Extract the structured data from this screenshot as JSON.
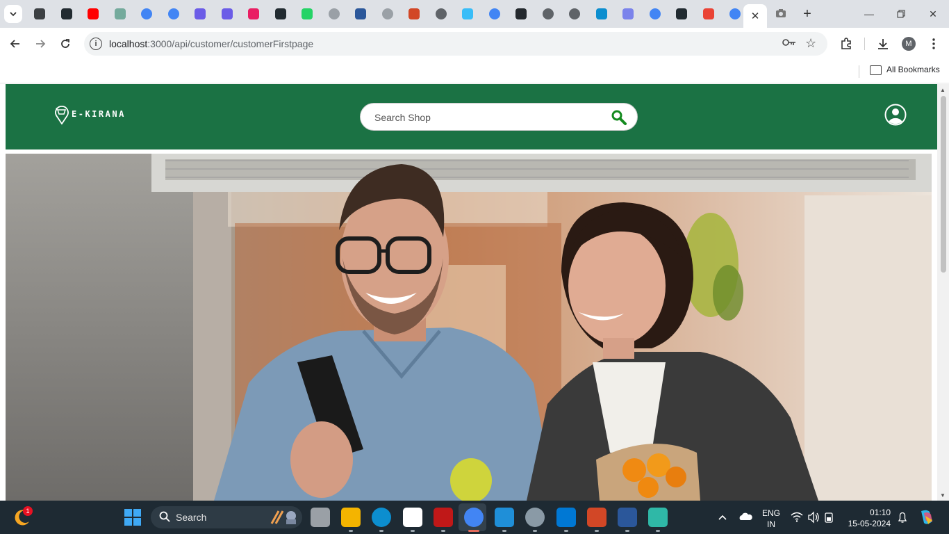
{
  "browser": {
    "address_bar": {
      "host": "localhost",
      "path": ":3000/api/customer/customerFirstpage"
    },
    "bookmarks_bar": {
      "all_bookmarks_label": "All Bookmarks"
    },
    "profile_initial": "M",
    "tabs": [
      {
        "icon": "maps-stack-icon",
        "color": "#3c4043"
      },
      {
        "icon": "react-app-icon",
        "color": "#222b31"
      },
      {
        "icon": "youtube-icon",
        "color": "#ff0000"
      },
      {
        "icon": "chatgpt-icon",
        "color": "#74aa9c"
      },
      {
        "icon": "google-icon",
        "color": "#4285f4"
      },
      {
        "icon": "google-icon",
        "color": "#4285f4"
      },
      {
        "icon": "copilot-icon",
        "color": "#6b5ce7"
      },
      {
        "icon": "copilot-icon",
        "color": "#6b5ce7"
      },
      {
        "icon": "react-icon",
        "color": "#e91e63"
      },
      {
        "icon": "react-app-icon",
        "color": "#222b31"
      },
      {
        "icon": "whatsapp-icon",
        "color": "#25d366"
      },
      {
        "icon": "globe-icon",
        "color": "#9aa0a6"
      },
      {
        "icon": "word-icon",
        "color": "#2b579a"
      },
      {
        "icon": "globe-icon",
        "color": "#9aa0a6"
      },
      {
        "icon": "powerpoint-icon",
        "color": "#d24726"
      },
      {
        "icon": "chrome-icon",
        "color": "#5f6368"
      },
      {
        "icon": "tailwind-icon",
        "color": "#38bdf8"
      },
      {
        "icon": "google-icon",
        "color": "#4285f4"
      },
      {
        "icon": "github-icon",
        "color": "#24292e"
      },
      {
        "icon": "chrome-icon",
        "color": "#5f6368"
      },
      {
        "icon": "chrome-icon",
        "color": "#5f6368"
      },
      {
        "icon": "edge-icon",
        "color": "#0c8ecf"
      },
      {
        "icon": "teams-icon",
        "color": "#7b83eb"
      },
      {
        "icon": "google-icon",
        "color": "#4285f4"
      },
      {
        "icon": "react-app-icon",
        "color": "#222b31"
      },
      {
        "icon": "gmail-icon",
        "color": "#ea4335"
      },
      {
        "icon": "google-icon",
        "color": "#4285f4"
      }
    ]
  },
  "site": {
    "brand_color": "#1b7244",
    "logo_text": "E-KIRANA",
    "search": {
      "placeholder": "Search Shop"
    }
  },
  "taskbar": {
    "weather_badge": "1",
    "search_label": "Search",
    "language": "ENG",
    "region": "IN",
    "time": "01:10",
    "date": "15-05-2024",
    "apps": [
      {
        "name": "task-view-icon",
        "color": "#9aa0a6"
      },
      {
        "name": "file-explorer-icon",
        "color": "#f4b400"
      },
      {
        "name": "edge-icon",
        "color": "#0c8ecf"
      },
      {
        "name": "microsoft-store-icon",
        "color": "#ffffff"
      },
      {
        "name": "mcafee-icon",
        "color": "#c01818"
      },
      {
        "name": "chrome-icon",
        "color": "#4285f4"
      },
      {
        "name": "vscode-icon",
        "color": "#1f8fd8"
      },
      {
        "name": "settings-icon",
        "color": "#8a9aa6"
      },
      {
        "name": "defender-icon",
        "color": "#0078d4"
      },
      {
        "name": "powerpoint-icon",
        "color": "#d24726"
      },
      {
        "name": "word-icon",
        "color": "#2b579a"
      },
      {
        "name": "git-icon",
        "color": "#2fb8a7"
      }
    ]
  }
}
